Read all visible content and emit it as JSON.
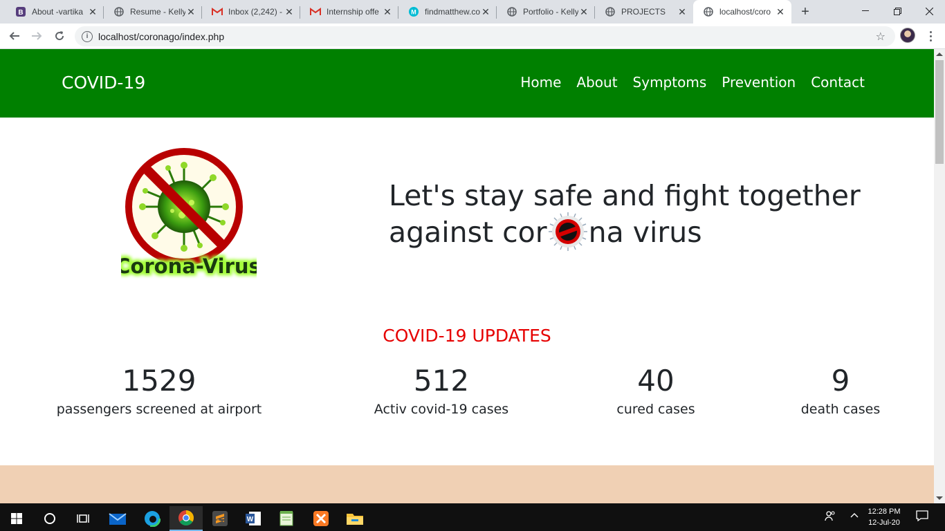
{
  "browser": {
    "tabs": [
      {
        "title": "About -vartika",
        "favicon": "bootstrap-icon",
        "color": "#563d7c",
        "active": false
      },
      {
        "title": "Resume - Kelly",
        "favicon": "globe-icon",
        "color": "#5f6368",
        "active": false
      },
      {
        "title": "Inbox (2,242) -",
        "favicon": "gmail-icon",
        "color": "#d93025",
        "active": false
      },
      {
        "title": "Internship offe",
        "favicon": "gmail-icon",
        "color": "#d93025",
        "active": false
      },
      {
        "title": "findmatthew.co",
        "favicon": "findmatthew-icon",
        "color": "#00bcd4",
        "active": false
      },
      {
        "title": "Portfolio - Kelly",
        "favicon": "globe-icon",
        "color": "#5f6368",
        "active": false
      },
      {
        "title": "PROJECTS",
        "favicon": "globe-icon",
        "color": "#5f6368",
        "active": false
      },
      {
        "title": "localhost/coro",
        "favicon": "globe-icon",
        "color": "#5f6368",
        "active": true
      }
    ],
    "url": "localhost/coronago/index.php"
  },
  "site": {
    "brand": "COVID-19",
    "nav": [
      "Home",
      "About",
      "Symptoms",
      "Prevention",
      "Contact"
    ],
    "hero": {
      "logo_text": "Corona-Virus",
      "line1": "Let's stay safe and fight together",
      "line2_before": "against cor",
      "line2_after": "na virus"
    },
    "updates_title": "COVID-19 UPDATES",
    "stats": [
      {
        "value": "1529",
        "label": "passengers screened at airport"
      },
      {
        "value": "512",
        "label": "Activ covid-19 cases"
      },
      {
        "value": "40",
        "label": "cured cases"
      },
      {
        "value": "9",
        "label": "death cases"
      }
    ],
    "colors": {
      "nav_bg": "#008000",
      "updates_title": "#e60000",
      "section_bg": "#f0d0b4"
    }
  },
  "taskbar": {
    "time": "12:28 PM",
    "date": "12-Jul-20"
  }
}
